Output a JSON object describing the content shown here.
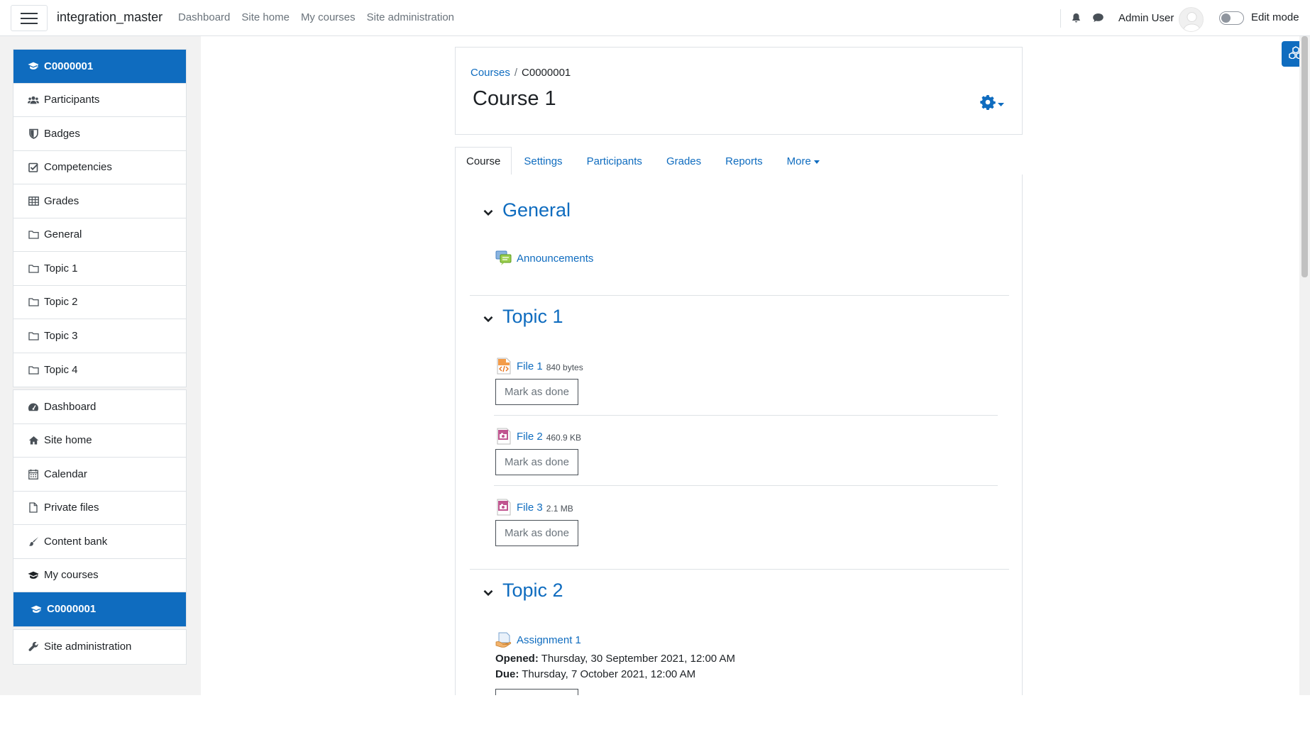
{
  "navbar": {
    "brand": "integration_master",
    "links": [
      "Dashboard",
      "Site home",
      "My courses",
      "Site administration"
    ],
    "user_name": "Admin User",
    "edit_mode_label": "Edit mode"
  },
  "drawer": {
    "course_group": [
      {
        "label": "C0000001",
        "icon": "graduation-cap-icon",
        "active": true
      },
      {
        "label": "Participants",
        "icon": "users-icon"
      },
      {
        "label": "Badges",
        "icon": "shield-icon"
      },
      {
        "label": "Competencies",
        "icon": "check-square-icon"
      },
      {
        "label": "Grades",
        "icon": "table-icon"
      },
      {
        "label": "General",
        "icon": "folder-icon"
      },
      {
        "label": "Topic 1",
        "icon": "folder-icon"
      },
      {
        "label": "Topic 2",
        "icon": "folder-icon"
      },
      {
        "label": "Topic 3",
        "icon": "folder-icon"
      },
      {
        "label": "Topic 4",
        "icon": "folder-icon"
      }
    ],
    "site_group": [
      {
        "label": "Dashboard",
        "icon": "dashboard-icon"
      },
      {
        "label": "Site home",
        "icon": "home-icon"
      },
      {
        "label": "Calendar",
        "icon": "calendar-icon"
      },
      {
        "label": "Private files",
        "icon": "file-icon"
      },
      {
        "label": "Content bank",
        "icon": "brush-icon"
      },
      {
        "label": "My courses",
        "icon": "graduation-cap-icon"
      },
      {
        "label": "C0000001",
        "icon": "graduation-cap-icon",
        "active": true
      }
    ],
    "admin_group": [
      {
        "label": "Site administration",
        "icon": "wrench-icon"
      }
    ]
  },
  "header": {
    "breadcrumb_root": "Courses",
    "breadcrumb_sep": "/",
    "breadcrumb_current": "C0000001",
    "title": "Course 1"
  },
  "tabs": [
    "Course",
    "Settings",
    "Participants",
    "Grades",
    "Reports",
    "More"
  ],
  "sections": {
    "general": {
      "title": "General",
      "activities": [
        {
          "name": "Announcements",
          "icon": "forum-icon"
        }
      ]
    },
    "topic1": {
      "title": "Topic 1",
      "activities": [
        {
          "name": "File 1",
          "meta": "840 bytes",
          "icon": "html-file-icon"
        },
        {
          "name": "File 2",
          "meta": "460.9 KB",
          "icon": "image-file-icon"
        },
        {
          "name": "File 3",
          "meta": "2.1 MB",
          "icon": "image-file-icon"
        }
      ]
    },
    "topic2": {
      "title": "Topic 2",
      "activities": [
        {
          "name": "Assignment 1",
          "icon": "assignment-icon",
          "opened_label": "Opened:",
          "opened_value": "Thursday, 30 September 2021, 12:00 AM",
          "due_label": "Due:",
          "due_value": "Thursday, 7 October 2021, 12:00 AM"
        }
      ]
    }
  },
  "mark_done_label": "Mark as done",
  "colors": {
    "primary": "#0f6cbf",
    "text": "#1d2125",
    "border": "#dee2e6",
    "drawer_bg": "#f2f2f2"
  }
}
